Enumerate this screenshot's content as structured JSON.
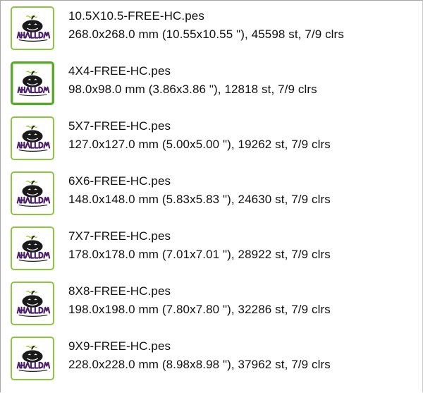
{
  "files": [
    {
      "name": "10.5X10.5-FREE-HC.pes",
      "info": "268.0x268.0 mm (10.55x10.55 \"), 45598 st, 7/9 clrs",
      "thumb_icon": "happy-halloween-embroidery-icon",
      "selected": false
    },
    {
      "name": "4X4-FREE-HC.pes",
      "info": "98.0x98.0 mm (3.86x3.86 \"), 12818 st, 7/9 clrs",
      "thumb_icon": "happy-halloween-embroidery-icon",
      "selected": true
    },
    {
      "name": "5X7-FREE-HC.pes",
      "info": "127.0x127.0 mm (5.00x5.00 \"), 19262 st, 7/9 clrs",
      "thumb_icon": "happy-halloween-embroidery-icon",
      "selected": false
    },
    {
      "name": "6X6-FREE-HC.pes",
      "info": "148.0x148.0 mm (5.83x5.83 \"), 24630 st, 7/9 clrs",
      "thumb_icon": "happy-halloween-embroidery-icon",
      "selected": false
    },
    {
      "name": "7X7-FREE-HC.pes",
      "info": "178.0x178.0 mm (7.01x7.01 \"), 28922 st, 7/9 clrs",
      "thumb_icon": "happy-halloween-embroidery-icon",
      "selected": false
    },
    {
      "name": "8X8-FREE-HC.pes",
      "info": "198.0x198.0 mm (7.80x7.80 \"), 32286 st, 7/9 clrs",
      "thumb_icon": "happy-halloween-embroidery-icon",
      "selected": false
    },
    {
      "name": "9X9-FREE-HC.pes",
      "info": "228.0x228.0 mm (8.98x8.98 \"), 37962 st, 7/9 clrs",
      "thumb_icon": "happy-halloween-embroidery-icon",
      "selected": false
    }
  ],
  "colors": {
    "thumb_border": "#8cc63f",
    "halloween_purple": "#4b1d6b",
    "pumpkin_black": "#1a1a1a",
    "happy_green": "#9acd32"
  }
}
